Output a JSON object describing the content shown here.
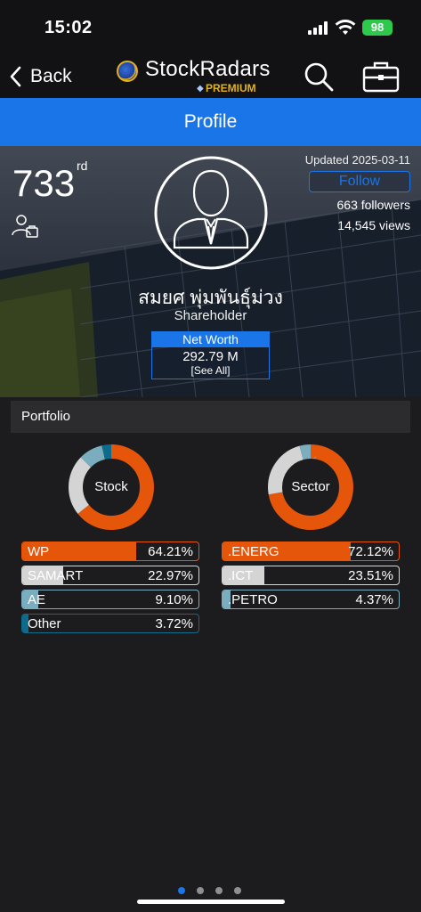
{
  "status_bar": {
    "time": "15:02",
    "battery": "98"
  },
  "nav": {
    "back_label": "Back",
    "brand": "StockRadars",
    "premium": "PREMIUM"
  },
  "page_title": "Profile",
  "profile": {
    "rank": "733",
    "rank_suffix": "rd",
    "updated": "Updated 2025-03-11",
    "follow_label": "Follow",
    "followers": "663 followers",
    "views": "14,545 views",
    "name": "สมยศ พุ่มพันธุ์ม่วง",
    "role": "Shareholder",
    "networth_label": "Net Worth",
    "networth_value": "292.79 M",
    "networth_link": "[See All]"
  },
  "portfolio": {
    "title": "Portfolio",
    "stock_chart": {
      "label": "Stock",
      "items": [
        {
          "name": "WP",
          "pct": "64.21%",
          "value": 64.21,
          "color": "#e5560b"
        },
        {
          "name": "SAMART",
          "pct": "22.97%",
          "value": 22.97,
          "color": "#d4d4d4"
        },
        {
          "name": "AE",
          "pct": "9.10%",
          "value": 9.1,
          "color": "#7aaebe"
        },
        {
          "name": "Other",
          "pct": "3.72%",
          "value": 3.72,
          "color": "#0e6b8a"
        }
      ]
    },
    "sector_chart": {
      "label": "Sector",
      "items": [
        {
          "name": ".ENERG",
          "pct": "72.12%",
          "value": 72.12,
          "color": "#e5560b"
        },
        {
          "name": ".ICT",
          "pct": "23.51%",
          "value": 23.51,
          "color": "#d4d4d4"
        },
        {
          "name": ".PETRO",
          "pct": "4.37%",
          "value": 4.37,
          "color": "#7aaebe"
        }
      ]
    }
  }
}
